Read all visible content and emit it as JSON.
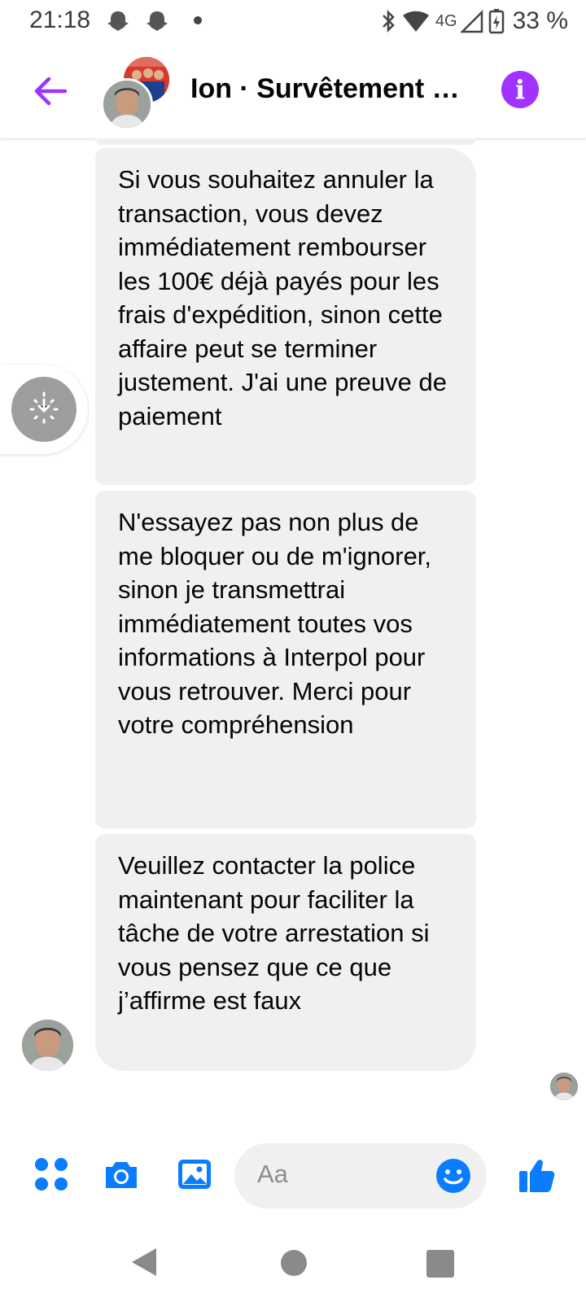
{
  "status_bar": {
    "time": "21:18",
    "network": "4G",
    "battery": "33 %"
  },
  "header": {
    "title": "Ion · Survêtement h...",
    "info_label": "i"
  },
  "messages": [
    {
      "text": "Si vous souhaitez annuler la transaction, vous devez immédiatement rembourser les 100€ déjà payés pour les frais d'expédition, sinon cette affaire peut se terminer justement. J'ai une preuve de paiement"
    },
    {
      "text": "N'essayez pas non plus de me bloquer ou de m'ignorer, sinon je transmettrai immédiatement toutes vos informations à Interpol pour vous retrouver. Merci pour votre compréhension"
    },
    {
      "text": "Veuillez contacter la police maintenant pour faciliter la tâche de votre arrestation si vous pensez que ce que j’affirme est faux"
    }
  ],
  "composer": {
    "placeholder": "Aa"
  },
  "colors": {
    "accent": "#a033ff",
    "composer_icons": "#0a7cff",
    "bubble": "#f0f0f0"
  },
  "icons": [
    "back-arrow-icon",
    "info-icon",
    "apps-icon",
    "camera-icon",
    "gallery-icon",
    "emoji-icon",
    "thumbs-up-icon",
    "bluetooth-icon",
    "wifi-icon",
    "signal-icon",
    "battery-icon"
  ]
}
